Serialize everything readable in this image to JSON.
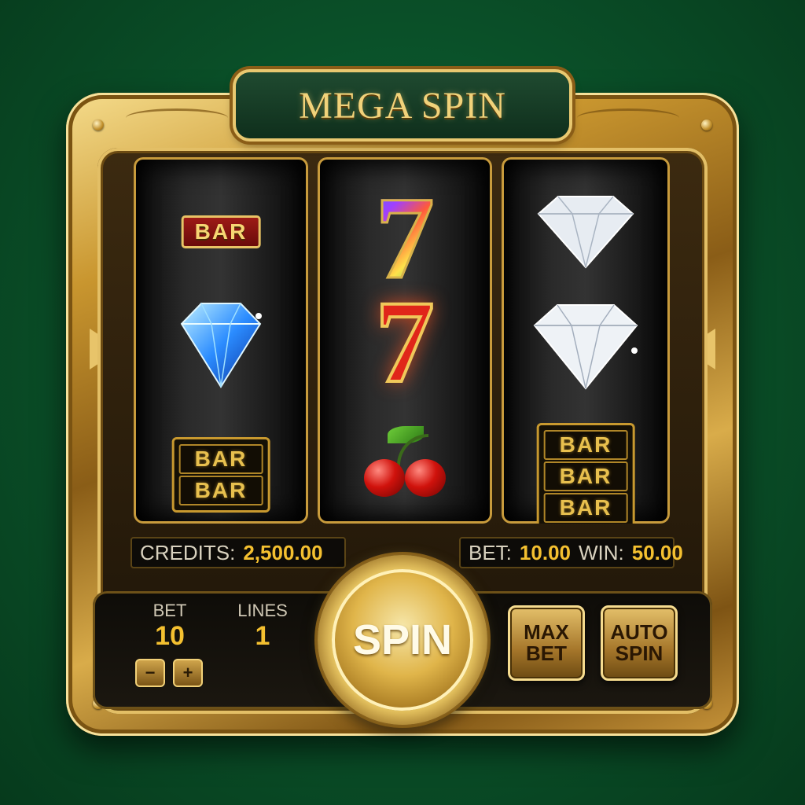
{
  "title": "MEGA SPIN",
  "reels": [
    {
      "symbols": [
        "BAR",
        "blue-diamond",
        "DOUBLE BAR"
      ]
    },
    {
      "symbols": [
        "rainbow-seven",
        "red-seven",
        "cherry"
      ]
    },
    {
      "symbols": [
        "white-diamond",
        "white-diamond",
        "TRIPLE BAR"
      ]
    }
  ],
  "symbol_text": {
    "bar": "BAR",
    "seven": "7"
  },
  "status": {
    "credits_label": "CREDITS:",
    "credits_value": "2,500.00",
    "bet_label": "BET:",
    "bet_value": "10.00",
    "win_label": "WIN:",
    "win_value": "50.00"
  },
  "controls": {
    "bet_label": "BET",
    "bet_value": "10",
    "lines_label": "LINES",
    "lines_value": "1",
    "minus": "−",
    "plus": "+",
    "spin": "SPIN",
    "max_bet": "MAX\nBET",
    "auto_spin": "AUTO\nSPIN"
  },
  "colors": {
    "felt": "#0a4f28",
    "gold": "#c9962f",
    "value_yellow": "#f4c030"
  }
}
